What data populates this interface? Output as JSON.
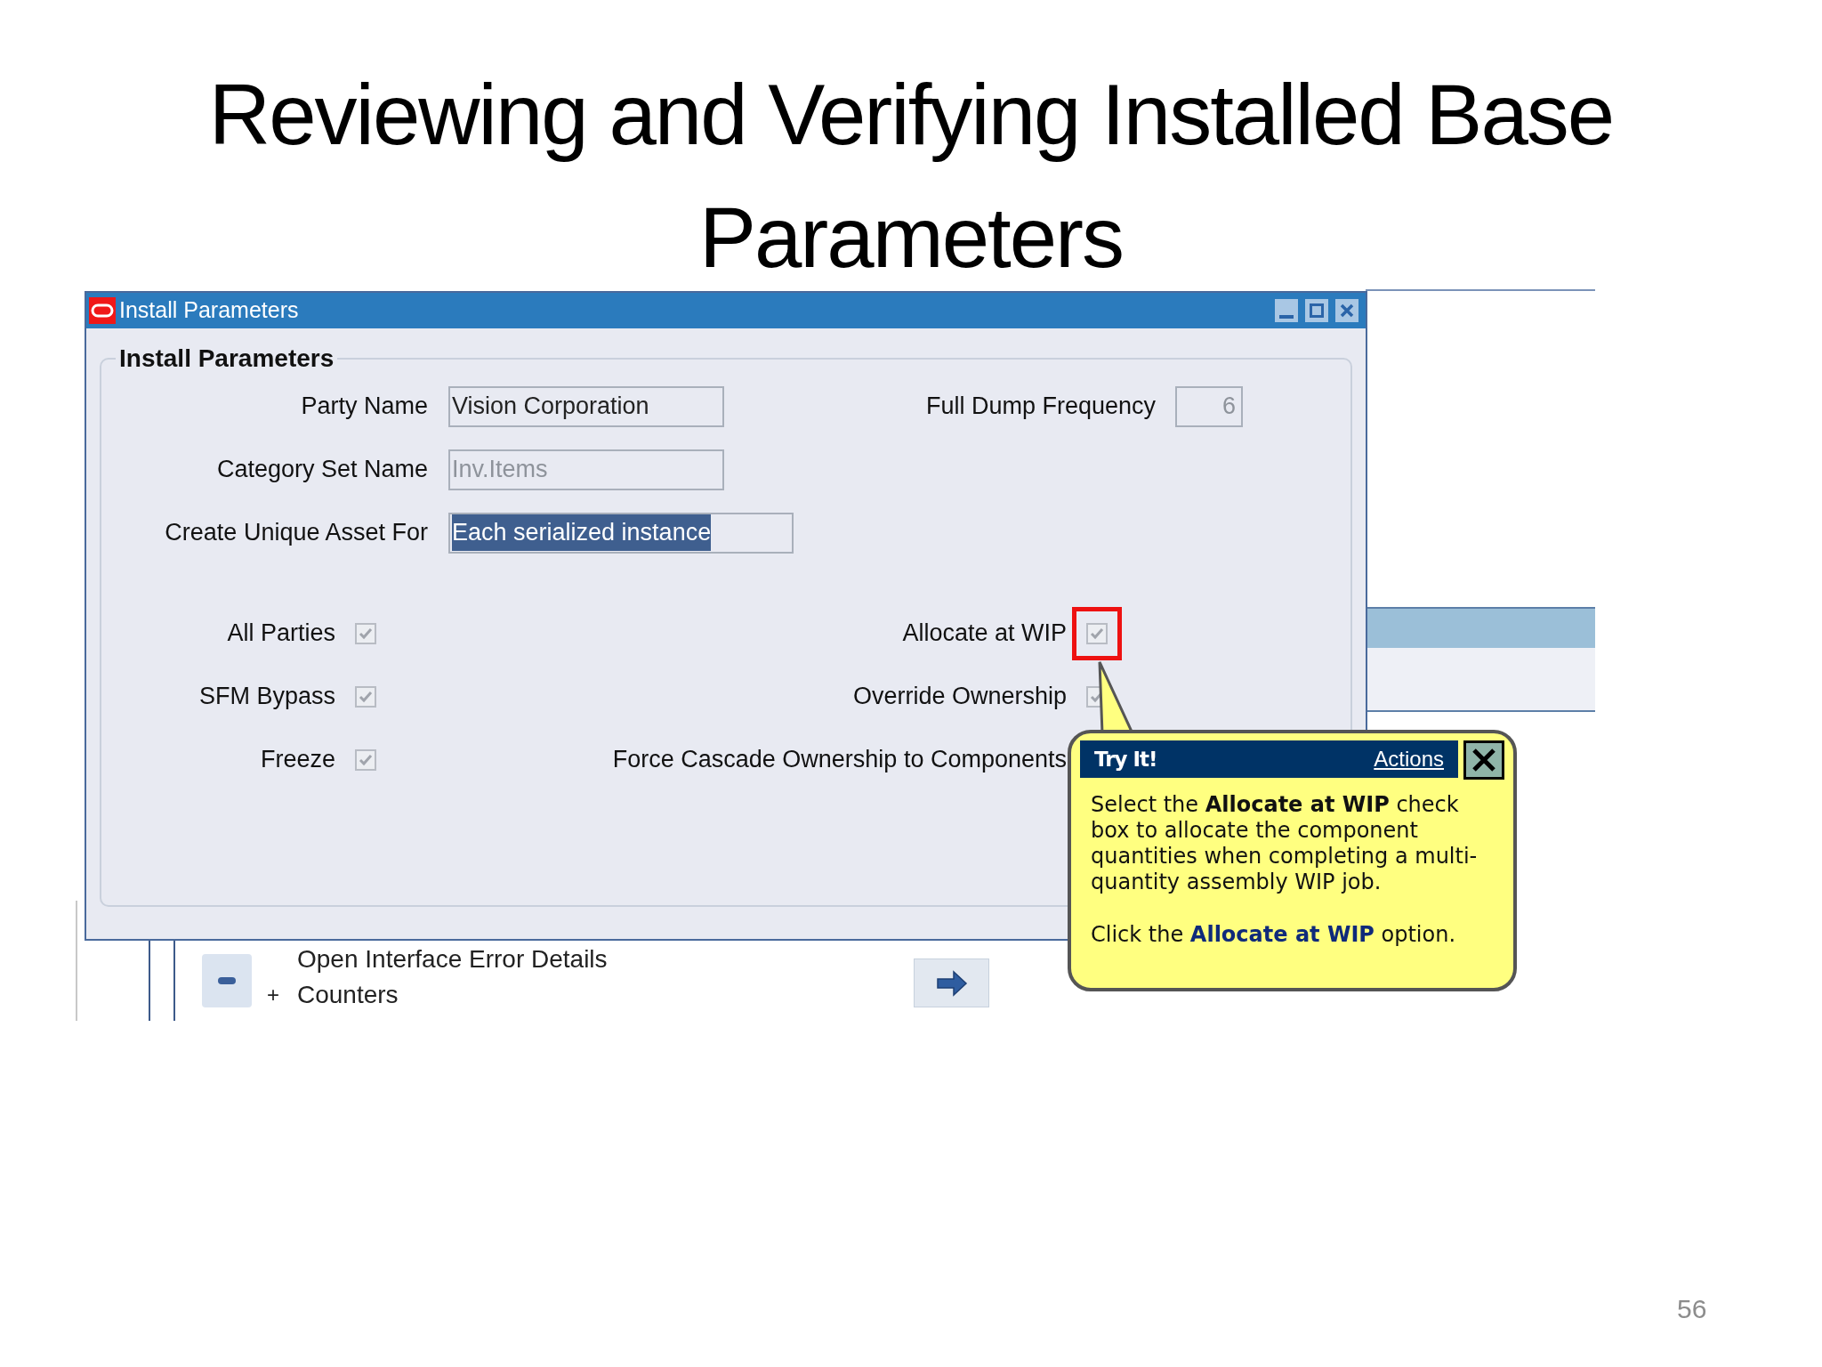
{
  "slide": {
    "title": "Reviewing and Verifying Installed Base Parameters",
    "page_number": "56"
  },
  "window": {
    "title": "Install Parameters"
  },
  "group": {
    "title": "Install Parameters"
  },
  "fields_left": [
    {
      "label": "Party Name",
      "value": "Vision Corporation",
      "disabled": false,
      "selected": false,
      "wide": false
    },
    {
      "label": "Category Set Name",
      "value": "Inv.Items",
      "disabled": true,
      "selected": false,
      "wide": false
    },
    {
      "label": "Create Unique Asset For",
      "value": "Each serialized instance",
      "disabled": false,
      "selected": true,
      "wide": true
    }
  ],
  "fields_right": [
    {
      "label": "Full Dump Frequency",
      "value": "6",
      "disabled": true
    }
  ],
  "checkboxes_left": [
    {
      "label": "All Parties",
      "checked": true
    },
    {
      "label": "SFM Bypass",
      "checked": true
    },
    {
      "label": "Freeze",
      "checked": true
    }
  ],
  "checkboxes_right": [
    {
      "label": "Allocate at WIP",
      "kind": "checkbox",
      "checked": true,
      "highlighted": true
    },
    {
      "label": "Override Ownership",
      "kind": "checkbox",
      "checked": true,
      "highlighted": false
    },
    {
      "label": "Force Cascade Ownership to Components",
      "kind": "label"
    }
  ],
  "background_list": [
    {
      "label": "Open Interface Error Details"
    },
    {
      "expander": "+",
      "label": "Counters"
    }
  ],
  "callout": {
    "title": "Try It!",
    "link": "Actions",
    "paragraphs": [
      "Select the **Allocate at WIP** check box to allocate the component quantities when completing a multi-quantity assembly WIP job.",
      "Click the **Allocate at WIP** option."
    ]
  }
}
